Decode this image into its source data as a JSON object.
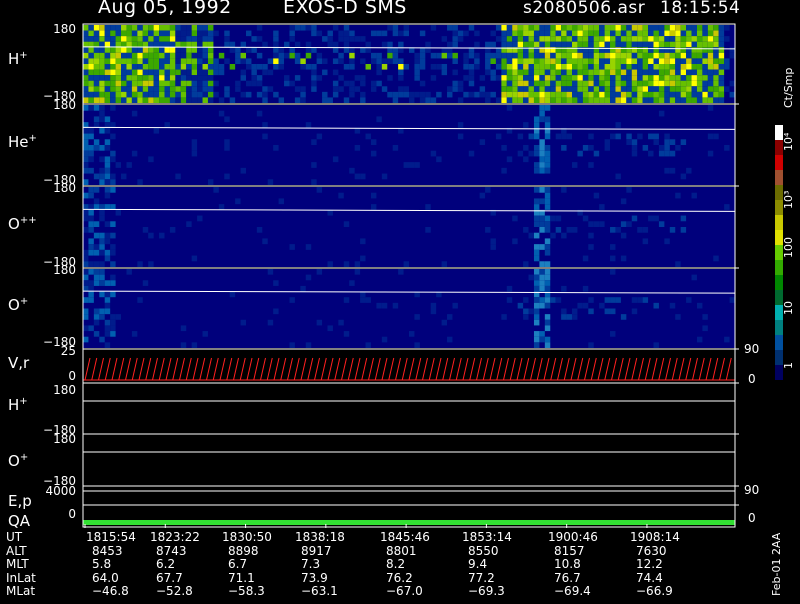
{
  "header": {
    "date": "Aug 05, 1992",
    "instrument": "EXOS-D SMS",
    "file": "s2080506.asr",
    "time": "18:15:54"
  },
  "side_note": "Feb-01 2AA",
  "chart_data": {
    "type": "heatmap",
    "time_ticks": [
      "1815:54",
      "1823:22",
      "1830:50",
      "1838:18",
      "1845:46",
      "1853:14",
      "1900:46",
      "1908:14"
    ],
    "panels": [
      {
        "label": "H",
        "charge": "+",
        "y_top": "180",
        "y_bottom": "−180"
      },
      {
        "label": "He",
        "charge": "+",
        "y_top": "180",
        "y_bottom": "−180"
      },
      {
        "label": "O",
        "charge": "++",
        "y_top": "180",
        "y_bottom": "−180"
      },
      {
        "label": "O",
        "charge": "+",
        "y_top": "180",
        "y_bottom": "−180"
      }
    ],
    "vr_panel": {
      "label": "V,r",
      "y_ticks": [
        "25",
        "0"
      ],
      "right_ticks": [
        "90",
        "0"
      ]
    },
    "h_angle_panel": {
      "label": "H",
      "charge": "+",
      "y_ticks": [
        "180",
        "−180"
      ]
    },
    "o_angle_panel": {
      "label": "O",
      "charge": "+",
      "y_ticks": [
        "180",
        "−180"
      ]
    },
    "ep_panel": {
      "label": "E,p",
      "y_ticks": [
        "4000"
      ],
      "right_ticks": [
        "90"
      ]
    },
    "qa_panel": {
      "label": "QA",
      "y_ticks": [
        "0"
      ],
      "right_ticks": [
        "0"
      ]
    },
    "colorbar": {
      "unit": "Ct/Smp",
      "ticks": [
        "10⁴",
        "10³",
        "100",
        "10",
        "1"
      ],
      "colors": [
        "#ffffff",
        "#8b0000",
        "#d00000",
        "#a05030",
        "#6b6b00",
        "#8c8c00",
        "#c8c800",
        "#e0e000",
        "#66cc00",
        "#33aa00",
        "#008800",
        "#006a30",
        "#00b0b0",
        "#008080",
        "#0050a0",
        "#003070",
        "#000060"
      ]
    },
    "orbit": {
      "rows": [
        {
          "name": "UT",
          "values": [
            "1815:54",
            "1823:22",
            "1830:50",
            "1838:18",
            "1845:46",
            "1853:14",
            "1900:46",
            "1908:14"
          ]
        },
        {
          "name": "ALT",
          "values": [
            "8453",
            "8743",
            "8898",
            "8917",
            "8801",
            "8550",
            "8157",
            "7630"
          ]
        },
        {
          "name": "MLT",
          "values": [
            "5.8",
            "6.2",
            "6.7",
            "7.3",
            "8.2",
            "9.4",
            "10.8",
            "12.2"
          ]
        },
        {
          "name": "InLat",
          "values": [
            "64.0",
            "67.7",
            "71.1",
            "73.9",
            "76.2",
            "77.2",
            "76.7",
            "74.4"
          ]
        },
        {
          "name": "MLat",
          "values": [
            "−46.8",
            "−52.8",
            "−58.3",
            "−63.1",
            "−67.0",
            "−69.3",
            "−69.4",
            "−66.9"
          ]
        }
      ]
    }
  }
}
